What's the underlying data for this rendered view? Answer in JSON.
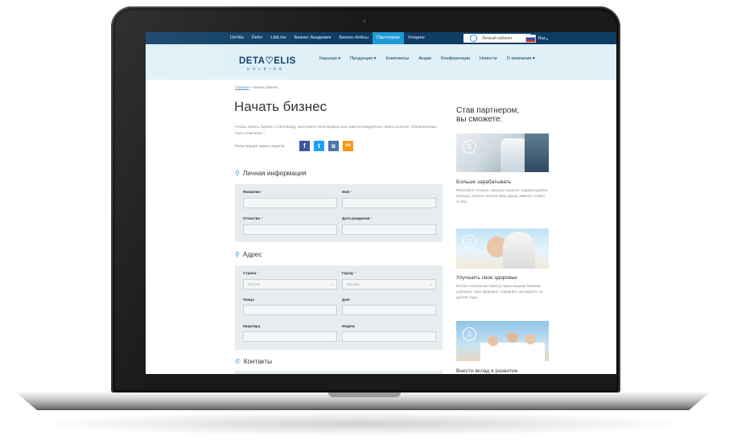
{
  "topnav": {
    "items": [
      "DeVita",
      "Defor",
      "LibiLine",
      "Бизнес Академия",
      "Бизнес-Кейсы",
      "Партнерам",
      "Холдинг"
    ],
    "active_index": 5,
    "cabinet_label": "Личный кабинет",
    "language": "Rus"
  },
  "logo": {
    "brand": "DETA♡ELIS",
    "sub": "HOLDING"
  },
  "mainnav": {
    "items": [
      "Карьера ▾",
      "Продукция ▾",
      "Комплексы",
      "Акции",
      "Конференции",
      "Новости",
      "О компании ▾"
    ]
  },
  "breadcrumb": {
    "home": "Главная",
    "separator": " » ",
    "current": "Начать бизнес"
  },
  "page_title": "Начать бизнес",
  "intro_text": "Чтобы начать бизнес с DEHolding, заполните поля формы или зарегистрируйтесь через соцсети. Обязательные поля отмечены *.",
  "social": {
    "label": "Регистрация через соцсети:",
    "buttons": [
      {
        "glyph": "f",
        "color": "#3b5998"
      },
      {
        "glyph": "t",
        "color": "#1da1f2"
      },
      {
        "glyph": "в",
        "color": "#4a76a8"
      },
      {
        "glyph": "ок",
        "color": "#f59a12"
      }
    ]
  },
  "sections": {
    "personal": {
      "title": "Личная информация",
      "icon": "user-icon"
    },
    "address": {
      "title": "Адрес",
      "icon": "map-pin-icon"
    },
    "contacts": {
      "title": "Контакты",
      "icon": "phone-icon"
    }
  },
  "fields": {
    "lastname": {
      "label": "Фамилия",
      "required": "*"
    },
    "firstname": {
      "label": "Имя",
      "required": "*"
    },
    "patronymic": {
      "label": "Отчество",
      "required": "*"
    },
    "birthdate": {
      "label": "Дата рождения",
      "required": "*"
    },
    "country": {
      "label": "Страна",
      "required": "*",
      "value": "Россия"
    },
    "city": {
      "label": "Город",
      "required": "*",
      "value": "Москва"
    },
    "street": {
      "label": "Улица"
    },
    "house": {
      "label": "Дом"
    },
    "apartment": {
      "label": "Квартира"
    },
    "zip": {
      "label": "Индекс"
    }
  },
  "sidebar": {
    "title_line1": "Став партнером,",
    "title_line2": "вы сможете:",
    "items": [
      {
        "num": "1",
        "title": "Больше зарабатывать",
        "text": "Работайте столько, сколько сможете, зарабатывайте сколько, сколько хотите! Ваш доход зависит только от вас."
      },
      {
        "num": "2",
        "title": "Улучшить свое здоровье",
        "text": "DeVita-технологии помогут вам и вашим близким улучшить свое здоровье, сохранить молодость на долгие годы."
      },
      {
        "num": "3",
        "title": "Внести вклад в развитие",
        "text": ""
      }
    ]
  },
  "colors": {
    "navy": "#0d3c64",
    "accent": "#1e9ad6",
    "header_bg": "#dff0f7",
    "panel": "#e7ecef"
  }
}
